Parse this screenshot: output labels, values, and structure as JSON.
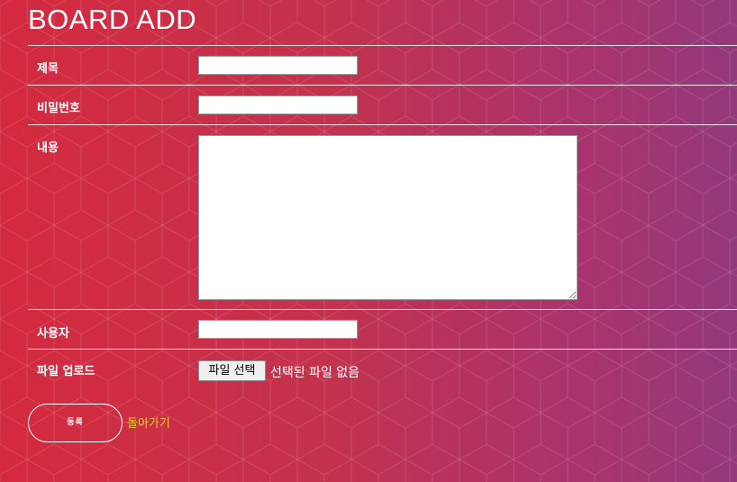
{
  "page": {
    "title": "BOARD ADD"
  },
  "form": {
    "title_label": "제목",
    "title_value": "",
    "password_label": "비밀번호",
    "password_value": "",
    "content_label": "내용",
    "content_value": "",
    "user_label": "사용자",
    "user_value": "",
    "file_label": "파일 업로드",
    "file_button_label": "파일 선택",
    "file_status": "선택된 파일 없음"
  },
  "actions": {
    "submit_label": "등록",
    "back_label": "돌아가기"
  },
  "colors": {
    "gradient_left": "#d42a3f",
    "gradient_right": "#93397a",
    "link": "#f0c63c"
  },
  "icons": {
    "background": "hexagon-pattern"
  }
}
